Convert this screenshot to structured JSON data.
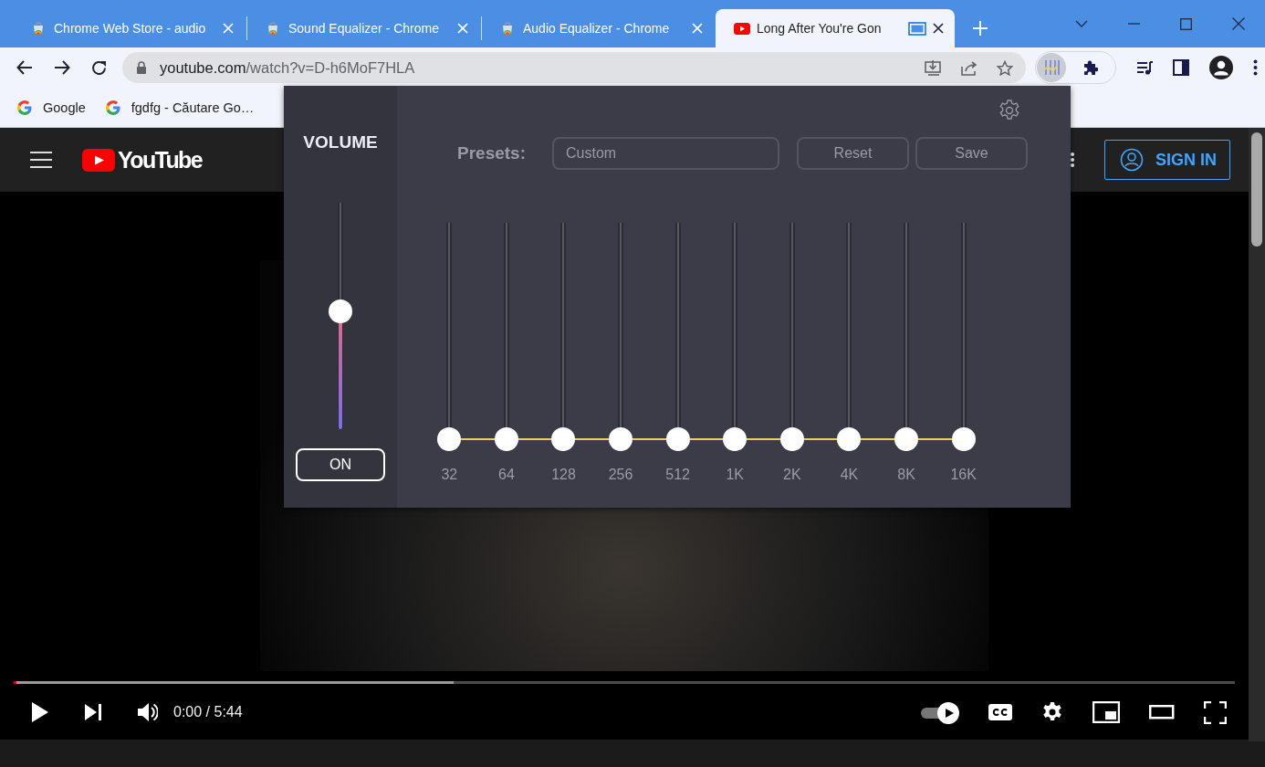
{
  "browser": {
    "tabs": [
      {
        "title": "Chrome Web Store - audio",
        "kind": "store",
        "selected": false,
        "sharing": false
      },
      {
        "title": "Sound Equalizer - Chrome",
        "kind": "store",
        "selected": false,
        "sharing": false
      },
      {
        "title": "Audio Equalizer - Chrome",
        "kind": "store",
        "selected": false,
        "sharing": false
      },
      {
        "title": "Long After You're Gon",
        "kind": "youtube",
        "selected": true,
        "sharing": true
      }
    ],
    "address": {
      "host": "youtube.com",
      "path": "/watch?v=D-h6MoF7HLA"
    },
    "extensions": [
      {
        "kind": "equalizer",
        "active": true
      },
      {
        "kind": "puzzle",
        "active": false
      }
    ],
    "bookmarks": [
      {
        "label": "Google"
      },
      {
        "label": "fgdfg - Căutare Go…"
      }
    ]
  },
  "youtube": {
    "logo": "YouTube",
    "sign_in": "SIGN IN",
    "player": {
      "progress": {
        "level": 0.36
      },
      "time": "0:00 / 5:44",
      "autoplay": {
        "on": true
      }
    }
  },
  "equalizer": {
    "volume_title": "VOLUME",
    "volume": {
      "level": 0.52
    },
    "power": {
      "label": "ON",
      "on": true
    },
    "presets_label": "Presets:",
    "preset": {
      "value": "Custom"
    },
    "buttons": [
      "Reset",
      "Save"
    ],
    "bands": [
      {
        "label": "32",
        "level": 0
      },
      {
        "label": "64",
        "level": 0
      },
      {
        "label": "128",
        "level": 0
      },
      {
        "label": "256",
        "level": 0
      },
      {
        "label": "512",
        "level": 0
      },
      {
        "label": "1K",
        "level": 0
      },
      {
        "label": "2K",
        "level": 0
      },
      {
        "label": "4K",
        "level": 0
      },
      {
        "label": "8K",
        "level": 0
      },
      {
        "label": "16K",
        "level": 0
      }
    ]
  }
}
